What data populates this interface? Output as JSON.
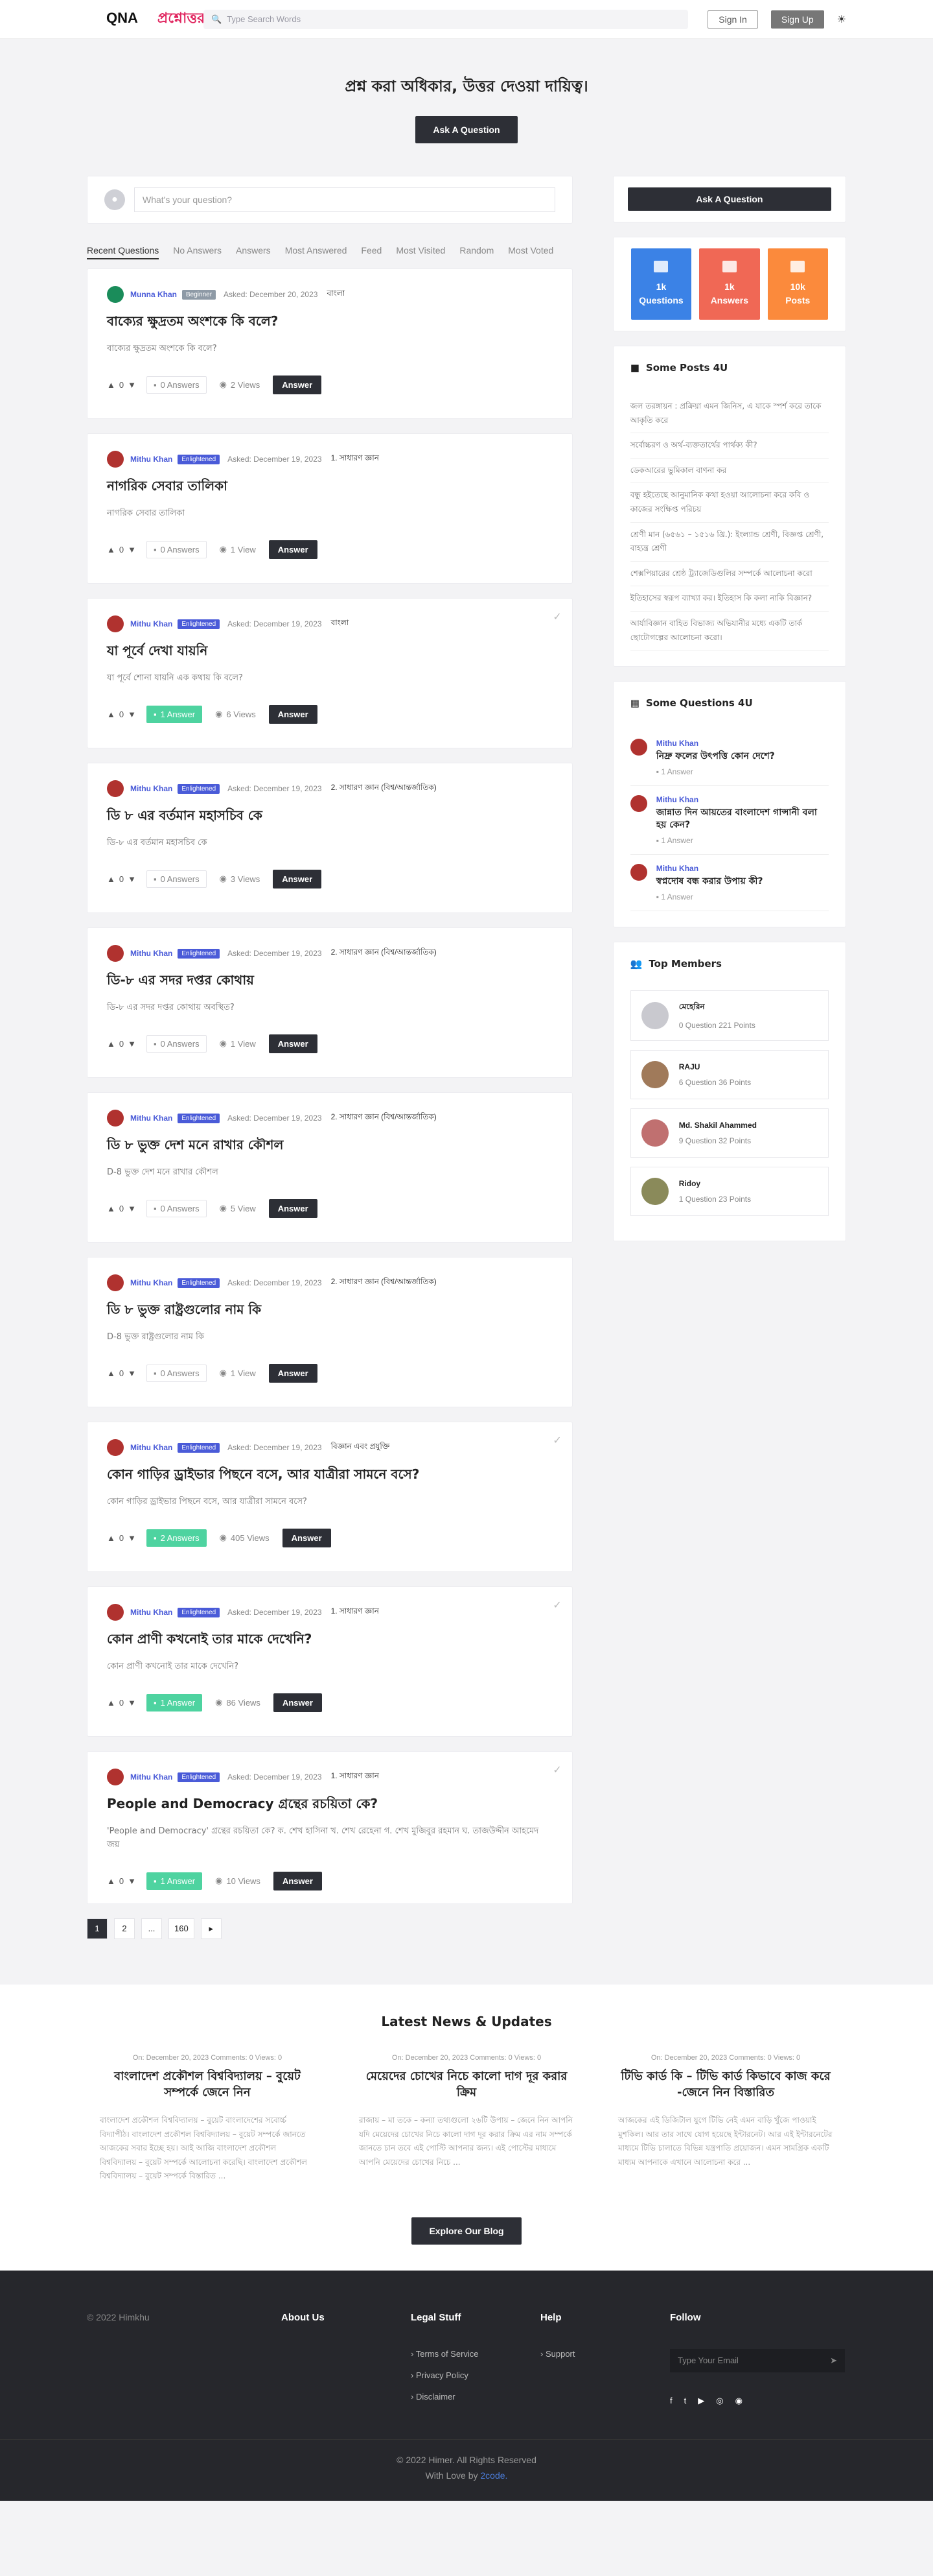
{
  "header": {
    "logo_a": "QNA",
    "logo_b": "প্রশ্নোত্তর",
    "search_placeholder": "Type Search Words",
    "signin": "Sign In",
    "signup": "Sign Up",
    "theme": "☀"
  },
  "hero": {
    "title": "প্রশ্ন করা অধিকার, উত্তর দেওয়া দায়িত্ব।",
    "button": "Ask A Question"
  },
  "askbox": {
    "placeholder": "What's your question?"
  },
  "tabs": [
    "Recent Questions",
    "No Answers",
    "Answers",
    "Most Answered",
    "Feed",
    "Most Visited",
    "Random",
    "Most Voted"
  ],
  "questions": [
    {
      "name": "Munna Khan",
      "badge": "Beginner",
      "asked": "Asked: December 20, 2023",
      "cat": "বাংলা",
      "title": "বাক্যের ক্ষুদ্রতম অংশকে কি বলে?",
      "excerpt": "বাক্যের ক্ষুদ্রতম অংশকে কি বলে?",
      "votes": "0",
      "answers": "0 Answers",
      "views": "2 Views"
    },
    {
      "name": "Mithu Khan",
      "badge": "Enlightened",
      "asked": "Asked: December 19, 2023",
      "cat": "1. সাধারণ জ্ঞান",
      "title": "নাগরিক সেবার তালিকা",
      "excerpt": "নাগরিক সেবার তালিকা",
      "votes": "0",
      "answers": "0 Answers",
      "views": "1 View"
    },
    {
      "name": "Mithu Khan",
      "badge": "Enlightened",
      "asked": "Asked: December 19, 2023",
      "cat": "বাংলা",
      "title": "যা পূর্বে দেখা যায়নি",
      "excerpt": "যা পূর্বে শোনা যায়নি এক কথায় কি বলে?",
      "votes": "0",
      "answers": "1 Answer",
      "views": "6 Views"
    },
    {
      "name": "Mithu Khan",
      "badge": "Enlightened",
      "asked": "Asked: December 19, 2023",
      "cat": "2. সাধারণ জ্ঞান (বিশ্ব/আন্তর্জাতিক)",
      "title": "ডি ৮ এর বর্তমান মহাসচিব কে",
      "excerpt": "ডি-৮ এর বর্তমান মহাসচিব কে",
      "votes": "0",
      "answers": "0 Answers",
      "views": "3 Views"
    },
    {
      "name": "Mithu Khan",
      "badge": "Enlightened",
      "asked": "Asked: December 19, 2023",
      "cat": "2. সাধারণ জ্ঞান (বিশ্ব/আন্তর্জাতিক)",
      "title": "ডি-৮ এর সদর দপ্তর কোথায়",
      "excerpt": "ডি-৮ এর সদর দপ্তর কোথায় অবস্থিত?",
      "votes": "0",
      "answers": "0 Answers",
      "views": "1 View"
    },
    {
      "name": "Mithu Khan",
      "badge": "Enlightened",
      "asked": "Asked: December 19, 2023",
      "cat": "2. সাধারণ জ্ঞান (বিশ্ব/আন্তর্জাতিক)",
      "title": "ডি ৮ ভুক্ত দেশ মনে রাখার কৌশল",
      "excerpt": "D-8 ভুক্ত দেশ মনে রাখার কৌশল",
      "votes": "0",
      "answers": "0 Answers",
      "views": "5 View"
    },
    {
      "name": "Mithu Khan",
      "badge": "Enlightened",
      "asked": "Asked: December 19, 2023",
      "cat": "2. সাধারণ জ্ঞান (বিশ্ব/আন্তর্জাতিক)",
      "title": "ডি ৮ ভুক্ত রাষ্ট্রগুলোর নাম কি",
      "excerpt": "D-8 ভুক্ত রাষ্ট্রগুলোর নাম কি",
      "votes": "0",
      "answers": "0 Answers",
      "views": "1 View"
    },
    {
      "name": "Mithu Khan",
      "badge": "Enlightened",
      "asked": "Asked: December 19, 2023",
      "cat": "বিজ্ঞান এবং প্রযুক্তি",
      "title": "কোন গাড়ির ড্রাইভার পিছনে বসে, আর যাত্রীরা সামনে বসে?",
      "excerpt": "কোন গাড়ির ড্রাইভার পিছনে বসে, আর যাত্রীরা সামনে বসে?",
      "votes": "0",
      "answers": "2 Answers",
      "views": "405 Views"
    },
    {
      "name": "Mithu Khan",
      "badge": "Enlightened",
      "asked": "Asked: December 19, 2023",
      "cat": "1. সাধারণ জ্ঞান",
      "title": "কোন প্রাণী কখনোই তার মাকে দেখেনি?",
      "excerpt": "কোন প্রাণী কখনোই তার মাকে দেখেনি?",
      "votes": "0",
      "answers": "1 Answer",
      "views": "86 Views"
    },
    {
      "name": "Mithu Khan",
      "badge": "Enlightened",
      "asked": "Asked: December 19, 2023",
      "cat": "1. সাধারণ জ্ঞান",
      "title": "People and Democracy গ্রন্থের রচয়িতা কে?",
      "excerpt": "'People and Democracy' গ্রন্থের রচয়িতা কে? ক. শেখ হাসিনা খ. শেখ রেহেনা গ. শেখ মুজিবুর রহমান ঘ. তাজউদ্দীন আহমেদ জয়",
      "votes": "0",
      "answers": "1 Answer",
      "views": "10 Views"
    }
  ],
  "pager": [
    "1",
    "2",
    "...",
    "160",
    "▸"
  ],
  "side": {
    "ask": "Ask A Question",
    "stats": [
      {
        "n": "1k",
        "l": "Questions",
        "c": "#3b82e6"
      },
      {
        "n": "1k",
        "l": "Answers",
        "c": "#f06855"
      },
      {
        "n": "10k",
        "l": "Posts",
        "c": "#fb8a3c"
      }
    ],
    "posts_title": "Some Posts 4U",
    "posts": [
      "জল তরঙ্গায়ন : প্রক্রিয়া এমন জিনিস, এ যাকে স্পর্শ করে তাকে আকৃতি করে",
      "সর্বোচ্চরণ ও অর্থ-ব্যক্ততার্থের পার্থক্য কী?",
      "ডেকআরের ভুমিকাল বাণনা কর",
      "বন্ধু হইতেছে আনুমানিক কথা হওয়া আলোচনা করে কবি ও কাজের সংক্ষিপ্ত পরিচয়",
      "শ্রেণী মান (৬৫৬১ – ১৫১৬ খ্রি.): ইংল্যান্ড শ্রেণী, বিজ্ঞপ্ত শ্রেণী, বাহ্যন্ত্র শ্রেণী",
      "শেক্সপিয়ারের শ্রেষ্ঠ ট্র্যাজেডিগুলির সম্পর্কে আলোচনা করো",
      "ইতিহাসের স্বরূপ ব্যাখ্যা কর। ইতিহাস কি কলা নাকি বিজ্ঞান?",
      "আর্যাবিজ্ঞান বাহিত বিভাজ্য অভিযানীর মধ্যে একটি তার্ক ছোটোগল্পের আলোচনা করো।"
    ],
    "sq_title": "Some Questions 4U",
    "sq": [
      {
        "n": "Mithu Khan",
        "t": "নিদ্রু ফলের উৎপত্তি কোন দেশে?",
        "a": "1 Answer"
      },
      {
        "n": "Mithu Khan",
        "t": "জান্নাত দিন আয়তের বাংলাদেশ গান্সানী বলা হয় কেন?",
        "a": "1 Answer"
      },
      {
        "n": "Mithu Khan",
        "t": "স্বপ্নদোষ বন্ধ করার উপায় কী?",
        "a": "1 Answer"
      }
    ],
    "mem_title": "Top Members",
    "members": [
      {
        "n": "মেহেরিন",
        "m": "0 Question  221 Points"
      },
      {
        "n": "RAJU",
        "m": "6 Question  36 Points"
      },
      {
        "n": "Md. Shakil Ahammed",
        "m": "9 Question  32 Points"
      },
      {
        "n": "Ridoy",
        "m": "1 Question  23 Points"
      }
    ]
  },
  "news": {
    "title": "Latest News & Updates",
    "cards": [
      {
        "meta": "On: December 20, 2023   Comments: 0   Views: 0",
        "title": "বাংলাদেশ প্রকৌশল বিশ্ববিদ্যালয় – বুয়েট সম্পর্কে জেনে নিন",
        "ex": "বাংলাদেশ প্রকৌশল বিশ্ববিদ্যালয় – বুয়েট বাংলাদেশের সবোর্চ্চ বিদ্যাপীঠ। বাংলাদেশ প্রকৌশল বিশ্ববিদ্যালয় – বুয়েট সম্পর্কে জানতে আজকের সবার ইচ্ছে হয়। আই আজি বাংলাদেশ প্রকৌশল বিশ্ববিদ্যালয় – বুয়েট সম্পর্কে আলোচনা করেছি। বাংলাদেশ প্রকৌশল বিশ্ববিদ্যালয় – বুয়েট সম্পর্কে বিস্তারিত ..."
      },
      {
        "meta": "On: December 20, 2023   Comments: 0   Views: 0",
        "title": "মেয়েদের চোখের নিচে কালো দাগ দূর করার ক্রিম",
        "ex": "রাজায় – মা তকে – কন্যা তথ্যগুলো ২৬টি উপায় – জেনে নিন আপনি যদি মেয়েদের চোখের নিচে কালো দাগ দূর করার ক্রিম এর নাম সম্পর্কে জানতে চান তবে এই পোস্টি আপনার জন্য। এই পোস্টের মাধ্যমে আপনি মেয়েদের চোখের নিচে ..."
      },
      {
        "meta": "On: December 20, 2023   Comments: 0   Views: 0",
        "title": "টিভি কার্ড কি – টিভি কার্ড কিভাবে কাজ করে -জেনে নিন বিস্তারিত",
        "ex": "আজকের এই ডিজিটাল যুগে টিভি নেই এমন বাড়ি খুঁজে পাওয়াই মুশকিল। আর তার সাথে যোগ হয়েছে ইন্টারনেট। আর এই ইন্টারনেটের মাধ্যমে টিভি চালাতে বিভিন্ন যন্ত্রপাতি প্রয়োজন। এমন সামগ্রিক একটি মাধ্যম আপনাকে এখানে আলোচনা করে ..."
      }
    ],
    "button": "Explore Our Blog"
  },
  "footer": {
    "copy": "© 2022 Himkhu",
    "about": "About Us",
    "legal": "Legal Stuff",
    "legal_links": [
      "Terms of Service",
      "Privacy Policy",
      "Disclaimer"
    ],
    "help": "Help",
    "help_links": [
      "Support"
    ],
    "follow": "Follow",
    "email": "Type Your Email",
    "socials": [
      "f",
      "t",
      "▶",
      "◎",
      "◉"
    ],
    "bottom1": "© 2022 Himer. All Rights Reserved",
    "bottom2": "With Love by",
    "bottom3": "2code."
  }
}
